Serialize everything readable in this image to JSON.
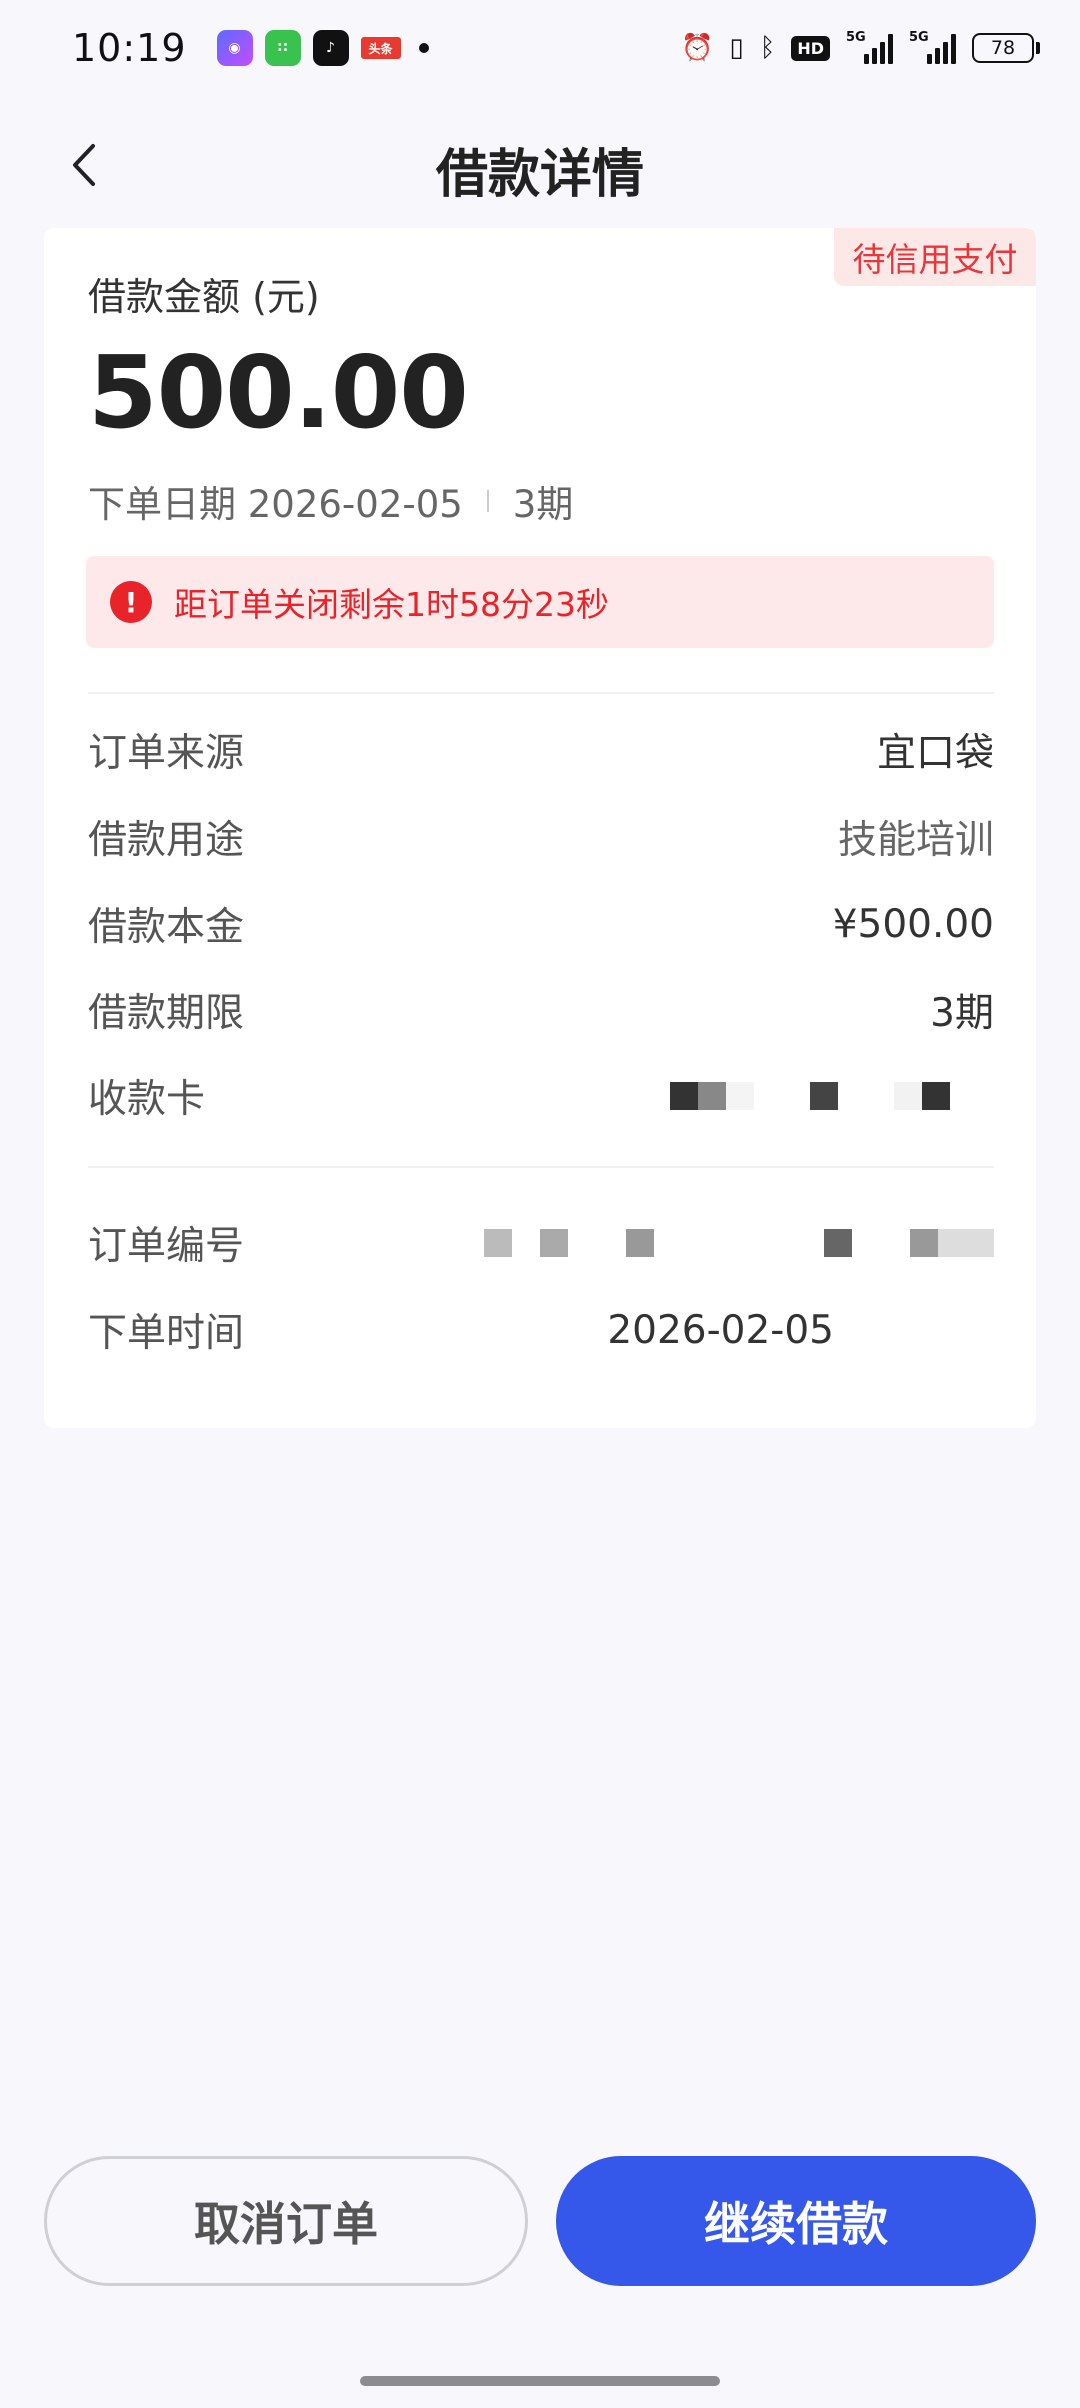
{
  "status_bar": {
    "time": "10:19",
    "apps": [
      "camera-app-icon",
      "wechat-mini-icon",
      "douyin-icon",
      "toutiao-icon"
    ],
    "toutiao_label": "头条",
    "hd_label": "HD",
    "signal1_label": "5G",
    "signal2_label": "5G",
    "battery": "78"
  },
  "nav": {
    "title": "借款详情"
  },
  "card": {
    "status_tag": "待信用支付",
    "amount_label": "借款金额 (元)",
    "amount_value": "500.00",
    "order_date": "下单日期 2026-02-05",
    "periods": "3期",
    "countdown": "距订单关闭剩余1时58分23秒",
    "rows": [
      {
        "label": "订单来源",
        "value": "宜口袋"
      },
      {
        "label": "借款用途",
        "value": "技能培训"
      },
      {
        "label": "借款本金",
        "value": "¥500.00"
      },
      {
        "label": "借款期限",
        "value": "3期"
      },
      {
        "label": "收款卡",
        "value": ""
      }
    ],
    "order_rows": [
      {
        "label": "订单编号",
        "value": ""
      },
      {
        "label": "下单时间",
        "value": "2026-02-05"
      }
    ]
  },
  "actions": {
    "cancel_label": "取消订单",
    "continue_label": "继续借款"
  },
  "colors": {
    "accent": "#3557ea",
    "danger": "#e8232a",
    "tag_bg": "#fde8e8",
    "page_bg": "#f7f7fc"
  }
}
